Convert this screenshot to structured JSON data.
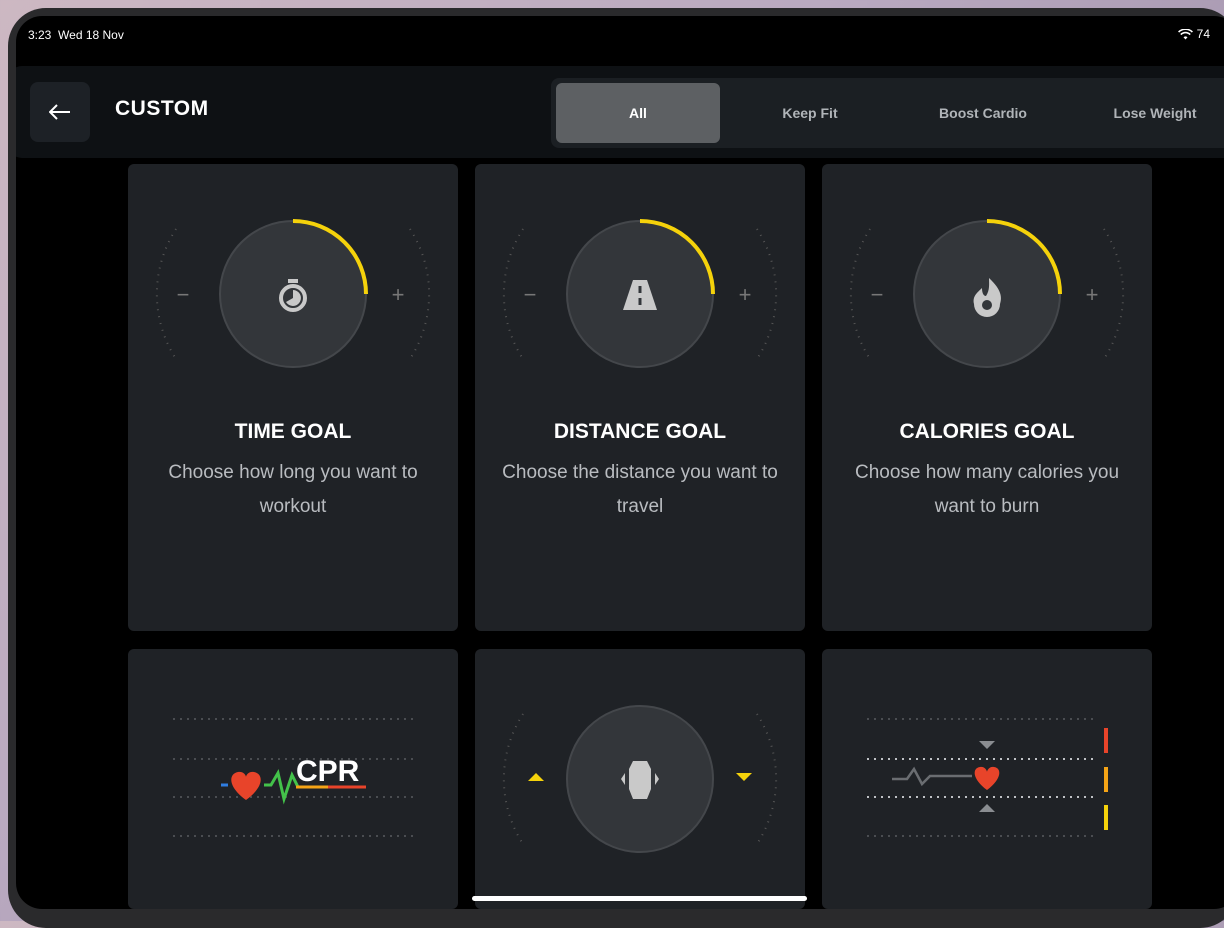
{
  "status_bar": {
    "time": "3:23",
    "date": "Wed 18 Nov",
    "battery": "74"
  },
  "header": {
    "title": "CUSTOM"
  },
  "tabs": [
    "All",
    "Keep Fit",
    "Boost Cardio",
    "Lose Weight"
  ],
  "active_tab": "All",
  "cards": [
    {
      "title": "TIME GOAL",
      "description": "Choose how long you want to workout",
      "icon": "stopwatch-icon"
    },
    {
      "title": "DISTANCE GOAL",
      "description": "Choose the distance you want to travel",
      "icon": "road-icon"
    },
    {
      "title": "CALORIES GOAL",
      "description": "Choose how many calories you want to burn",
      "icon": "flame-icon"
    },
    {
      "title": "",
      "description": "",
      "icon": "cpr-heart-icon",
      "logo_text": "CPR"
    },
    {
      "title": "",
      "description": "",
      "icon": "torso-icon"
    },
    {
      "title": "",
      "description": "",
      "icon": "heart-rate-zone-icon"
    }
  ],
  "colors": {
    "accent_yellow": "#f5d20b",
    "heart_red": "#e8442a",
    "card_bg": "#1f2226"
  }
}
